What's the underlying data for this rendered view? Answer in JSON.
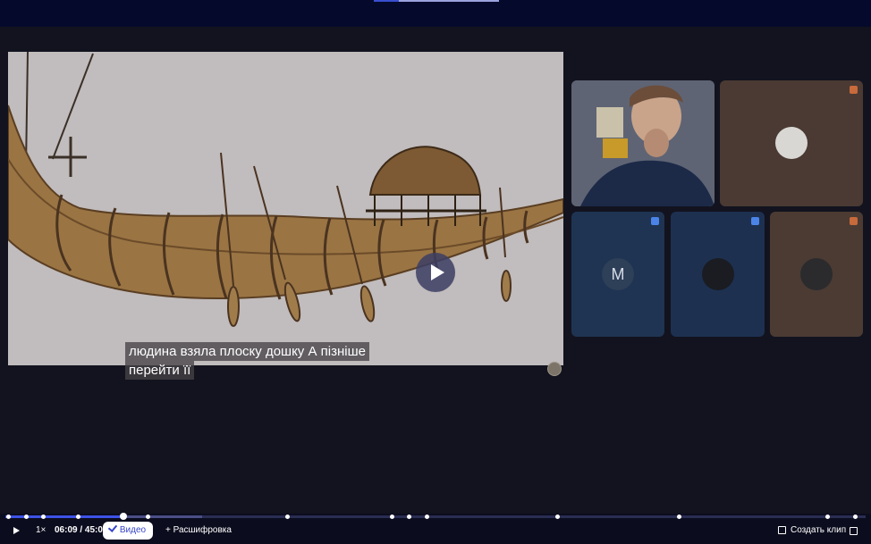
{
  "shared_screen": {
    "caption_line1": "людина взяла плоску дошку А пізніше",
    "caption_line2": "перейти її"
  },
  "participants": [
    {
      "type": "camera",
      "mic": "off"
    },
    {
      "type": "avatar",
      "mic": "off"
    },
    {
      "type": "letter",
      "initial": "M",
      "mic": "on"
    },
    {
      "type": "avatar",
      "mic": "on"
    },
    {
      "type": "avatar",
      "mic": "off"
    }
  ],
  "player": {
    "speed": "1×",
    "time": "06:09 / 45:09",
    "video_label": "Видео",
    "transcript_label": "Расшифровка",
    "clip_label": "Создать клип",
    "progress_fraction": 0.137
  },
  "colors": {
    "accent": "#3d52e6",
    "background": "#12131f",
    "mic_off": "#c76a3c",
    "mic_on": "#4b84e8"
  }
}
